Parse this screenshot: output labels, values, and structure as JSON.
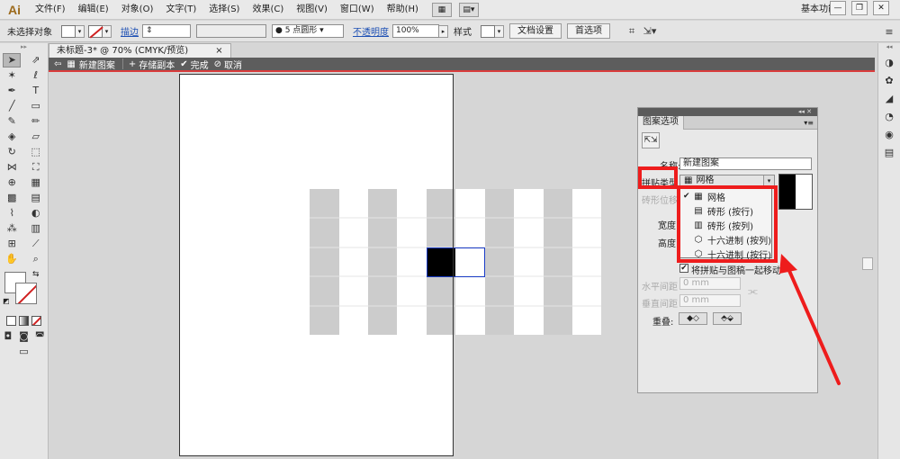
{
  "app": {
    "logo": "Ai",
    "menus": [
      "文件(F)",
      "编辑(E)",
      "对象(O)",
      "文字(T)",
      "选择(S)",
      "效果(C)",
      "视图(V)",
      "窗口(W)",
      "帮助(H)"
    ],
    "workspace": "基本功能",
    "win_minimize": "—",
    "win_restore": "❐",
    "win_close": "✕"
  },
  "control_bar": {
    "selection_status": "未选择对象",
    "stroke_label": "描边",
    "brush_value": "5 点圆形",
    "opacity_label": "不透明度",
    "opacity_value": "100%",
    "style_label": "样式",
    "doc_setup_button": "文档设置",
    "preferences_button": "首选项"
  },
  "document_tab": {
    "title": "未标题-3* @ 70% (CMYK/预览)",
    "close": "×"
  },
  "isolation_bar": {
    "mode_name": "新建图案",
    "save_copy": "存储副本",
    "done": "完成",
    "cancel": "取消"
  },
  "pattern_panel": {
    "tab": "图案选项",
    "name_label": "名称:",
    "name_value": "新建图案",
    "tile_type_label": "拼贴类型",
    "tile_type_value": "网格",
    "brick_offset_label": "砖形位移",
    "width_label": "宽度",
    "height_label": "高度",
    "move_tile_label": "将拼贴与图稿一起移动",
    "h_spacing_label": "水平间距",
    "h_spacing_value": "0 mm",
    "v_spacing_label": "垂直间距",
    "v_spacing_value": "0 mm",
    "overlap_label": "重叠:"
  },
  "tile_type_menu": {
    "items": [
      {
        "label": "网格",
        "checked": true
      },
      {
        "label": "砖形 (按行)",
        "checked": false
      },
      {
        "label": "砖形 (按列)",
        "checked": false
      },
      {
        "label": "十六进制 (按列)",
        "checked": false
      },
      {
        "label": "十六进制 (按行)",
        "checked": false
      }
    ]
  },
  "colors": {
    "annotation_red": "#ee1c1c",
    "tile_gray": "#cccccc",
    "selection_blue": "#1a3cc8",
    "isolation_bar": "#5d5d5d"
  }
}
